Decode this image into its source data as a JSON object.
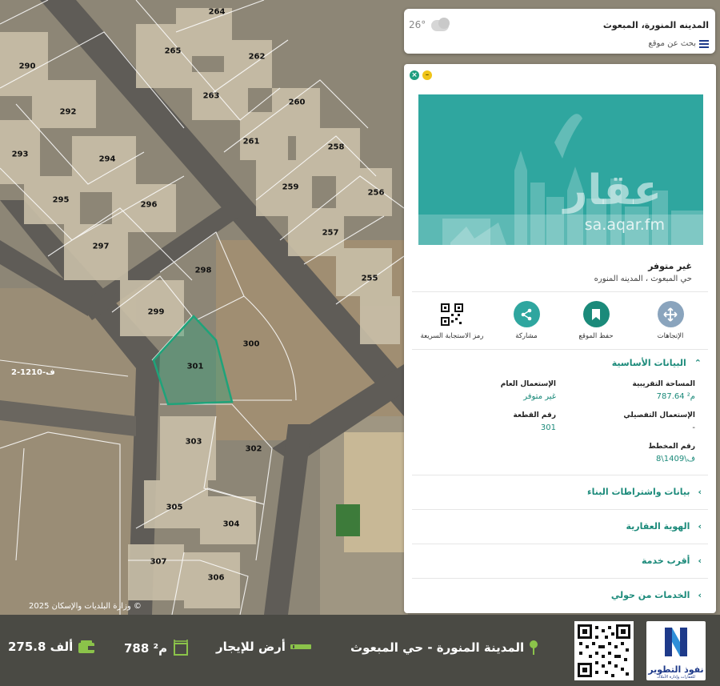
{
  "location_bar": {
    "title": "المدينه المنورة، المبعوث",
    "search_placeholder": "بحث عن موقع",
    "temperature": "26°"
  },
  "panel": {
    "banner_logo": "عقار",
    "banner_url": "sa.aqar.fm",
    "listing_title": "غير متوفر",
    "listing_location": "حي المبعوث ، المدينه المنوره",
    "actions": [
      {
        "label": "رمز الاستجابة السريعة",
        "icon": "qr-icon"
      },
      {
        "label": "مشاركة",
        "icon": "share-icon"
      },
      {
        "label": "حفظ الموقع",
        "icon": "bookmark-icon"
      },
      {
        "label": "الإتجاهات",
        "icon": "directions-icon"
      }
    ],
    "basic_info": {
      "title": "البيانات الأساسية",
      "area_label": "المساحة التقريبية",
      "area_value": "787.64 م²",
      "general_use_label": "الإستعمال العام",
      "general_use_value": "غير متوفر",
      "detailed_use_label": "الإستعمال التفصيلي",
      "detailed_use_value": "-",
      "plot_number_label": "رقم القطعة",
      "plot_number_value": "301",
      "plan_number_label": "رقم المخطط",
      "plan_number_value": "ف\\1409\\8"
    },
    "sections": [
      "بيانات واشتراطات البناء",
      "الهوية العقارية",
      "أقرب خدمة",
      "الخدمات من حولي"
    ]
  },
  "map": {
    "plots": [
      {
        "n": "264"
      },
      {
        "n": "265"
      },
      {
        "n": "262"
      },
      {
        "n": "263"
      },
      {
        "n": "260"
      },
      {
        "n": "290"
      },
      {
        "n": "292"
      },
      {
        "n": "261"
      },
      {
        "n": "258"
      },
      {
        "n": "293"
      },
      {
        "n": "294"
      },
      {
        "n": "259"
      },
      {
        "n": "256"
      },
      {
        "n": "295"
      },
      {
        "n": "296"
      },
      {
        "n": "257"
      },
      {
        "n": "297"
      },
      {
        "n": "298"
      },
      {
        "n": "255"
      },
      {
        "n": "299"
      },
      {
        "n": "300"
      },
      {
        "n": "301"
      },
      {
        "n": "303"
      },
      {
        "n": "302"
      },
      {
        "n": "305"
      },
      {
        "n": "304"
      },
      {
        "n": "307"
      },
      {
        "n": "306"
      }
    ],
    "ref_label": "2-1210-ف",
    "copyright": "وزارة البلديات والإسكان 2025 ©"
  },
  "bottom_bar": {
    "city": "المدينة المنورة - حي المبعوث",
    "type": "أرض للإيجار",
    "area": "788 م²",
    "price": "275.8 ألف",
    "brand_name": "نفوذ التطوير",
    "brand_sub": "للعقارات وإدارة الأملاك"
  },
  "colors": {
    "accent": "#1b8a7a",
    "banner": "#2fa69f",
    "selected_plot": "#1fa37a"
  }
}
